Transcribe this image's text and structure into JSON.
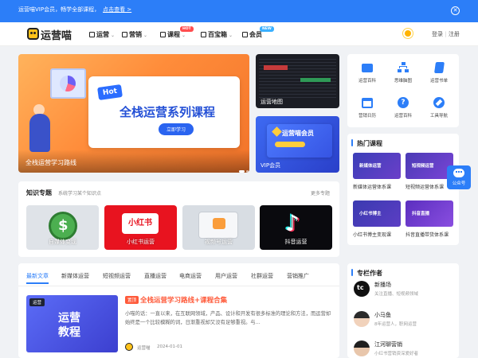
{
  "topbar": {
    "message": "运营喵VIP会员，畅学全部课程，",
    "link": "点击查看 >",
    "close_icon": "close-circle-icon"
  },
  "header": {
    "logo_text": "运营喵",
    "nav": [
      {
        "label": "运营",
        "icon": "calendar-icon",
        "has_dropdown": true
      },
      {
        "label": "营销",
        "icon": "bar-chart-icon",
        "has_dropdown": true
      },
      {
        "label": "课程",
        "icon": "graduation-cap-icon",
        "has_dropdown": true,
        "badge": "HOT"
      },
      {
        "label": "百宝箱",
        "icon": "toolbox-icon",
        "has_dropdown": true
      },
      {
        "label": "会员",
        "icon": "vip-icon",
        "has_dropdown": false,
        "badge": "NEW"
      }
    ],
    "login": "登录",
    "divider": "|",
    "register": "注册",
    "theme_icon": "sun-icon"
  },
  "banner": {
    "hot_tag": "Hot",
    "title": "全栈运营系列课程",
    "button": "立即学习",
    "caption": "全栈运营学习路线"
  },
  "side_tiles": [
    {
      "caption": "运营地图"
    },
    {
      "caption": "VIP会员",
      "card_title": "运营喵会员"
    }
  ],
  "knowledge": {
    "title": "知识专题",
    "subtitle": "系统学习某个知识点",
    "more": "更多专题",
    "items": [
      {
        "label": "自媒体变现"
      },
      {
        "label": "小红书运营",
        "brand": "小红书"
      },
      {
        "label": "视频号运营"
      },
      {
        "label": "抖音运营"
      }
    ]
  },
  "articles": {
    "tabs": [
      "最新文章",
      "新媒体运营",
      "短视频运营",
      "直播运营",
      "电商运营",
      "用户运营",
      "社群运营",
      "营销推广"
    ],
    "active_tab": 0,
    "post": {
      "thumb_tag": "运营",
      "thumb_title": "运营\n教程",
      "tag": "置顶",
      "title": "全栈运营学习路线+课程合集",
      "desc": "小喵的话：一直以来，在互联网领域，产品、设计和开发有很多标准的理论和方法，而运营却始终是一个比较模糊的词，日渐重视却又没有足够重视。与...",
      "author": "运营喵",
      "date": "2024-01-01"
    }
  },
  "tools": [
    {
      "label": "运营百科",
      "icon": "folder-icon"
    },
    {
      "label": "思维脑图",
      "icon": "mindmap-icon"
    },
    {
      "label": "运营书单",
      "icon": "book-icon"
    },
    {
      "label": "营销日历",
      "icon": "calendar-icon"
    },
    {
      "label": "运营百科",
      "icon": "question-icon"
    },
    {
      "label": "工具导航",
      "icon": "compass-icon"
    }
  ],
  "hot_courses": {
    "title": "热门课程",
    "items": [
      {
        "caption": "新媒体运营体系课",
        "thumb_text": "新媒体运营"
      },
      {
        "caption": "短视频运营体系课",
        "thumb_text": "短视频运营"
      },
      {
        "caption": "小红书博主变现课",
        "thumb_text": "小红书博主"
      },
      {
        "caption": "抖音直播带货体系课",
        "thumb_text": "抖音直播"
      }
    ]
  },
  "authors": {
    "title": "专栏作者",
    "items": [
      {
        "name": "新播场",
        "desc": "关注直播、短视频领域"
      },
      {
        "name": "小马鱼",
        "desc": "8年运营人，职网运营"
      },
      {
        "name": "江河聊营销",
        "desc": "小红书营销资深爱好者"
      }
    ]
  },
  "float_button": {
    "label": "公众号",
    "icon": "wechat-icon"
  },
  "colors": {
    "primary": "#2c7ef8",
    "accent": "#ff5a3a",
    "hot_badge": "#ff4d4f",
    "new_badge": "#3ab0ff"
  }
}
